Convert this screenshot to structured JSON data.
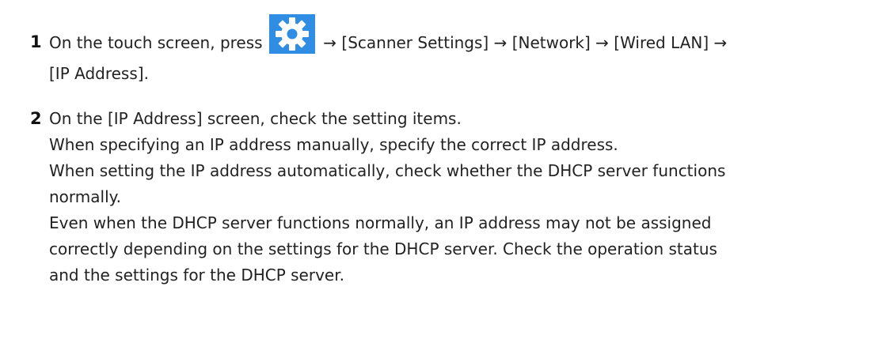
{
  "steps": [
    {
      "number": "1",
      "prefix": "On the touch screen, press",
      "icon": "gear-icon",
      "path_line1": "→ [Scanner Settings] → [Network] → [Wired LAN] →",
      "path_line2": "[IP Address]."
    },
    {
      "number": "2",
      "lines": [
        "On the [IP Address] screen, check the setting items.",
        "When specifying an IP address manually, specify the correct IP address.",
        "When setting the IP address automatically, check whether the DHCP server functions",
        "normally.",
        "Even when the DHCP server functions normally, an IP address may not be assigned",
        "correctly depending on the settings for the DHCP server. Check the operation status",
        "and the settings for the DHCP server."
      ]
    }
  ],
  "colors": {
    "icon_background": "#2f8de4",
    "icon_foreground": "#ffffff"
  }
}
